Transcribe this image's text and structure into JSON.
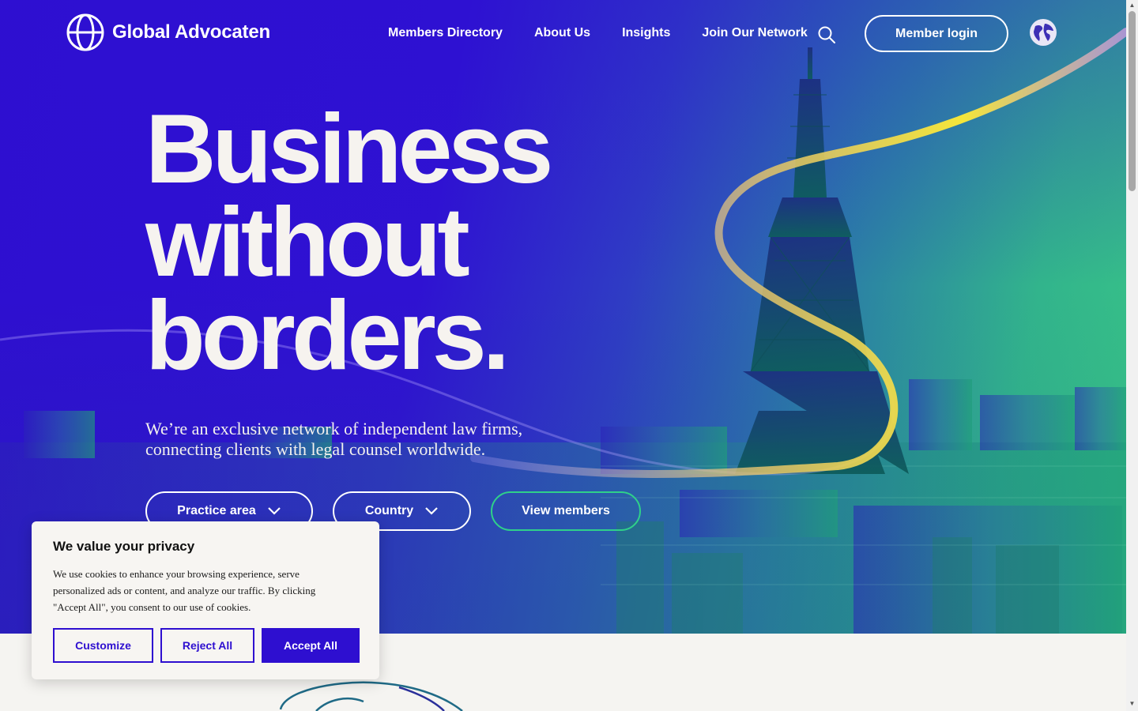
{
  "brand": {
    "name": "Global Advocaten",
    "primary_color": "#2e0fd0",
    "accent_color": "#2fd08a",
    "highlight_color": "#f3e73a"
  },
  "nav": {
    "items": [
      {
        "label": "Members Directory"
      },
      {
        "label": "About Us"
      },
      {
        "label": "Insights"
      },
      {
        "label": "Join Our Network"
      }
    ],
    "search_icon": "search-icon",
    "login_label": "Member login",
    "language_icon": "globe-icon"
  },
  "hero": {
    "headline_line1": "Business",
    "headline_line2": "without",
    "headline_line3": "borders.",
    "subcopy": "We’re an exclusive network of independent law firms, connecting clients with legal counsel worldwide.",
    "filters": {
      "practice_area": "Practice area",
      "country": "Country",
      "view_members": "View members"
    }
  },
  "cookie_banner": {
    "title": "We value your privacy",
    "text": "We use cookies to enhance your browsing experience, serve personalized ads or content, and analyze our traffic. By clicking \"Accept All\", you consent to our use of cookies.",
    "customize_label": "Customize",
    "reject_label": "Reject All",
    "accept_label": "Accept All"
  }
}
